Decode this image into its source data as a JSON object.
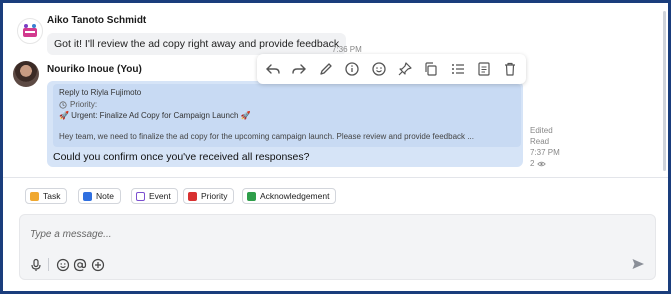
{
  "messages": [
    {
      "sender": "Aiko Tanoto Schmidt",
      "text": "Got it! I'll review the ad copy right away and provide feedback",
      "time": "7:36 PM"
    },
    {
      "sender": "Nouriko Inoue (You)",
      "reply": {
        "to_label": "Reply to Riyla Fujimoto",
        "priority_label": "Priority:",
        "title": "🚀 Urgent: Finalize Ad Copy for Campaign Launch 🚀",
        "preview": "Hey team, we need to finalize the ad copy for the upcoming campaign launch. Please review and provide feedback ..."
      },
      "text": "Could you confirm once you've received all responses?",
      "edited": "Edited",
      "read": "Read",
      "time": "7:37 PM",
      "views": "2"
    }
  ],
  "toolbar_icons": [
    "reply-icon",
    "forward-icon",
    "edit-icon",
    "info-icon",
    "emoji-react-icon",
    "pin-icon",
    "copy-icon",
    "list-icon",
    "note-icon",
    "delete-icon"
  ],
  "chips": [
    {
      "label": "Task",
      "color": "#f0a830"
    },
    {
      "label": "Note",
      "color": "#2f6fe0"
    },
    {
      "label": "Event",
      "color": "#7b4fd0"
    },
    {
      "label": "Priority",
      "color": "#d83030"
    },
    {
      "label": "Acknowledgement",
      "color": "#2e9e4a"
    }
  ],
  "composer": {
    "placeholder": "Type a message..."
  },
  "colors": {
    "frame_border": "#1a3d7c",
    "own_bubble": "#d6e4f7",
    "reply_card": "#c8daf3"
  }
}
